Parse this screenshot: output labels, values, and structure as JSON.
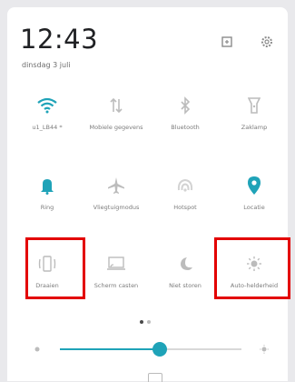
{
  "header": {
    "time": "12:43",
    "date": "dinsdag 3 juli"
  },
  "tiles_row1": [
    {
      "label": "u1_LB44 *",
      "icon": "wifi-icon"
    },
    {
      "label": "Mobiele gegevens",
      "icon": "mobile-data-icon"
    },
    {
      "label": "Bluetooth",
      "icon": "bluetooth-icon"
    },
    {
      "label": "Zaklamp",
      "icon": "flashlight-icon"
    }
  ],
  "tiles_row2": [
    {
      "label": "Ring",
      "icon": "bell-icon"
    },
    {
      "label": "Vliegtuigmodus",
      "icon": "airplane-icon"
    },
    {
      "label": "Hotspot",
      "icon": "hotspot-icon"
    },
    {
      "label": "Locatie",
      "icon": "location-icon"
    }
  ],
  "tiles_row3": [
    {
      "label": "Draaien",
      "icon": "rotate-icon"
    },
    {
      "label": "Scherm casten",
      "icon": "cast-icon"
    },
    {
      "label": "Niet storen",
      "icon": "moon-icon"
    },
    {
      "label": "Auto-helderheid",
      "icon": "brightness-icon"
    }
  ],
  "brightness": {
    "level": 0.55
  },
  "colors": {
    "accent": "#1fa3b8",
    "highlight": "#e30000",
    "icon_off": "#bcbcbc"
  }
}
